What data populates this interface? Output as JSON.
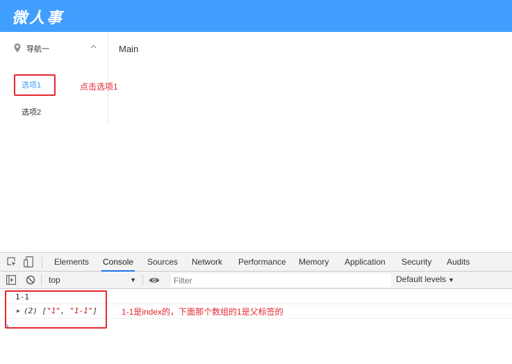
{
  "header": {
    "title": "微人事",
    "background": "#409eff"
  },
  "sidebar": {
    "submenu": {
      "label": "导航一",
      "icon": "location-icon",
      "expanded": true
    },
    "items": [
      {
        "label": "选项1",
        "active": true
      },
      {
        "label": "选项2",
        "active": false
      }
    ]
  },
  "main": {
    "text": "Main"
  },
  "annotations": {
    "click_note": "点击选项1",
    "console_note": "1-1是index的，下面那个数组的1是父标签的",
    "color": "#e3262e"
  },
  "devtools": {
    "tabs": [
      "Elements",
      "Console",
      "Sources",
      "Network",
      "Performance",
      "Memory",
      "Application",
      "Security",
      "Audits"
    ],
    "active_tab": "Console",
    "toolbar": {
      "context": "top",
      "filter_placeholder": "Filter",
      "levels": "Default levels"
    },
    "console": {
      "log_1": "1-1",
      "array_count": "(2)",
      "array_items": [
        "\"1\"",
        "\"1-1\""
      ]
    }
  }
}
